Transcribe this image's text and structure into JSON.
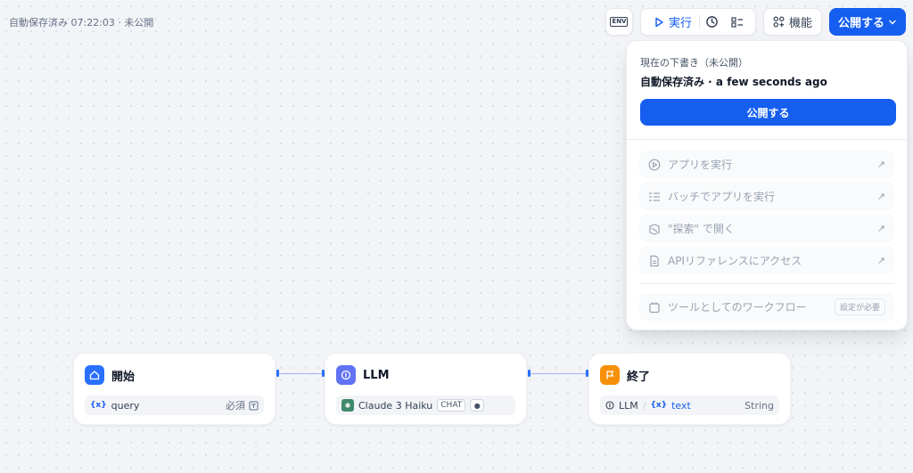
{
  "status": {
    "text": "自動保存済み 07:22:03 · 未公開"
  },
  "toolbar": {
    "env_label": "ENV",
    "run_label": "実行",
    "feature_label": "機能",
    "publish_label": "公開する"
  },
  "dropdown": {
    "draft_label": "現在の下書き（未公開）",
    "saved_text": "自動保存済み · a few seconds ago",
    "publish_label": "公開する",
    "items": [
      {
        "label": "アプリを実行"
      },
      {
        "label": "バッチでアプリを実行"
      },
      {
        "label": "\"探索\" で開く"
      },
      {
        "label": "APIリファレンスにアクセス"
      }
    ],
    "tool_label": "ツールとしてのワークフロー",
    "tool_tag": "設定が必要"
  },
  "nodes": {
    "start": {
      "title": "開始",
      "var_name": "query",
      "required": "必須"
    },
    "llm": {
      "title": "LLM",
      "model": "Claude 3 Haiku",
      "tag": "CHAT"
    },
    "end": {
      "title": "終了",
      "source": "LLM",
      "var": "text",
      "type": "String"
    }
  },
  "colors": {
    "primary": "#155eef",
    "start_icon": "#2970ff",
    "llm_icon": "#6172f3",
    "end_icon": "#f79009"
  }
}
